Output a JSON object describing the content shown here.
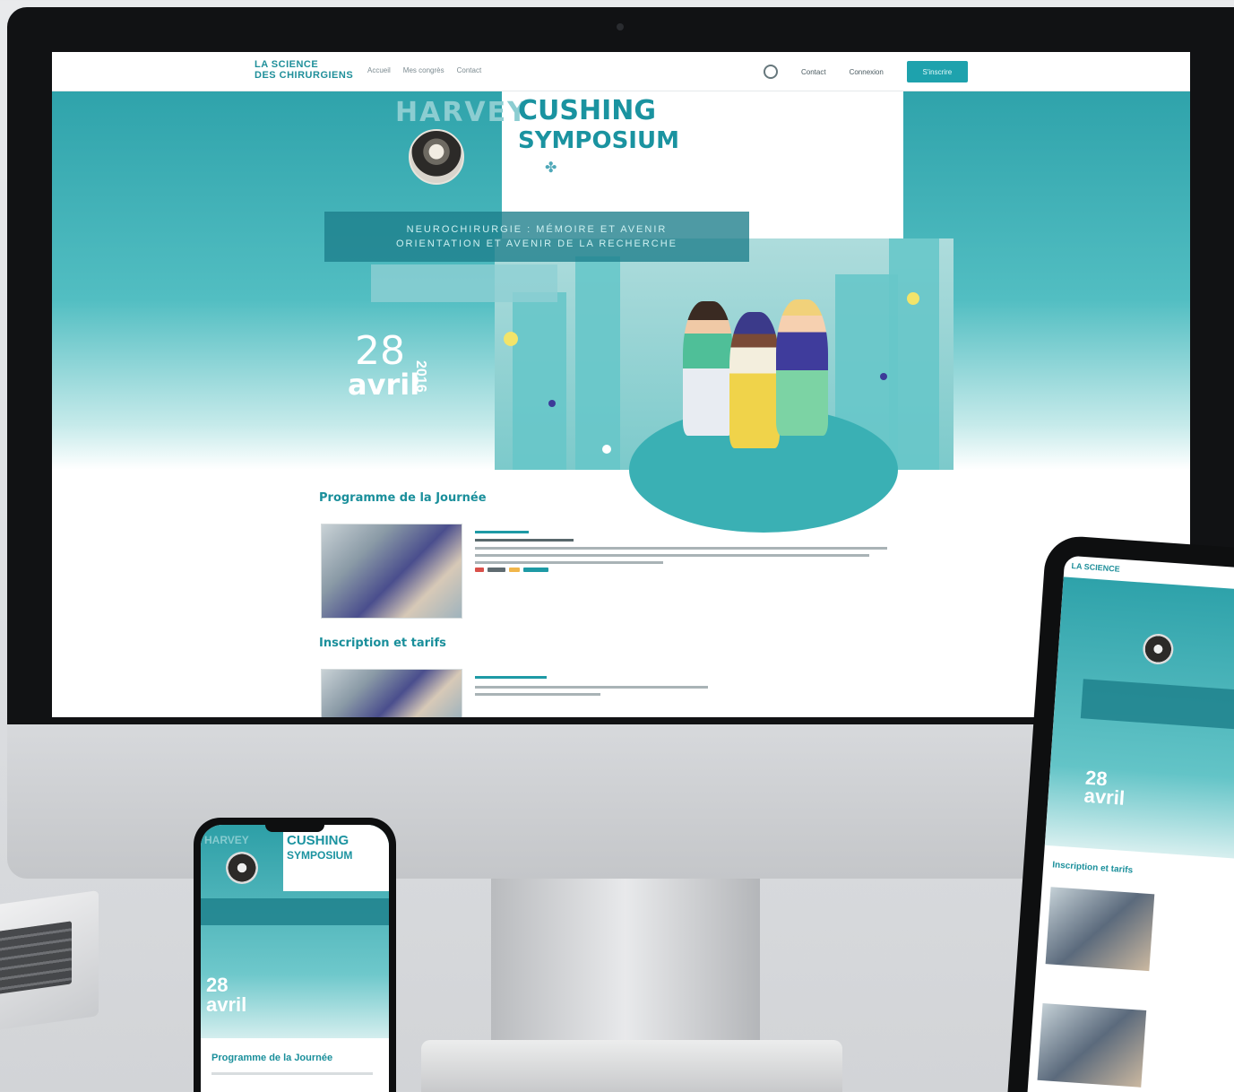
{
  "site": {
    "logo_line1": "LA SCIENCE",
    "logo_line2": "DES CHIRURGIENS",
    "nav": [
      "Accueil",
      "Mes congrès",
      "Contact"
    ],
    "nav_right": [
      "Contact",
      "Connexion"
    ],
    "cta_label": "S'inscrire"
  },
  "hero": {
    "title_part1": "HARVEY",
    "title_part2": "CUSHING",
    "title_part3": "SYMPOSIUM",
    "banner_line1": "NEUROCHIRURGIE : MÉMOIRE ET AVENIR",
    "banner_line2": "ORIENTATION ET AVENIR DE LA RECHERCHE",
    "date_day": "28",
    "date_month": "avril",
    "date_year": "2016"
  },
  "sections": [
    {
      "title": "Programme de la Journée"
    },
    {
      "title": "Inscription et tarifs"
    }
  ],
  "colors": {
    "teal": "#1ea2ad",
    "teal_dark": "#1a8f9b",
    "bezel": "#111214"
  }
}
